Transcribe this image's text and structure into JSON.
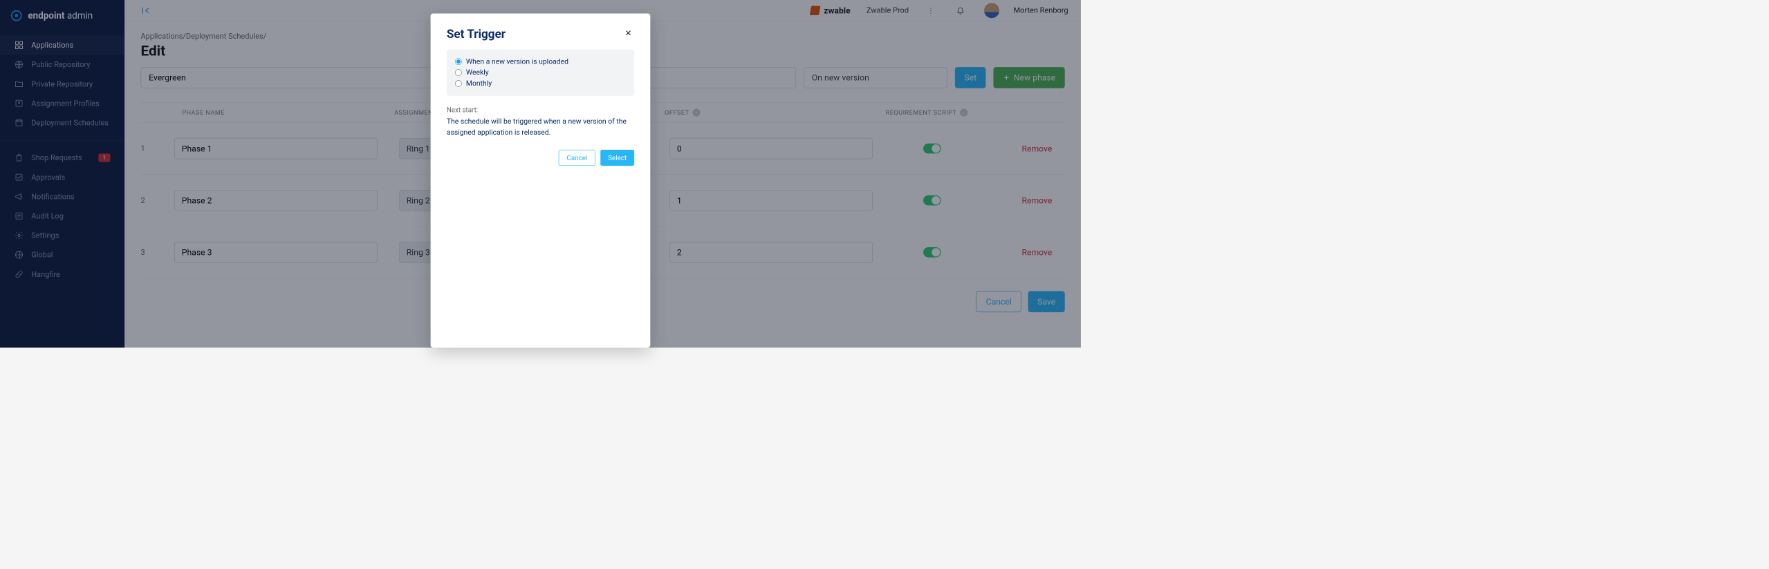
{
  "brand": {
    "logo_bold": "endpoint",
    "logo_light": " admin"
  },
  "sidebar": {
    "items": [
      {
        "label": "Applications",
        "icon": "apps"
      },
      {
        "label": "Public Repository",
        "icon": "globe"
      },
      {
        "label": "Private Repository",
        "icon": "folder-lock"
      },
      {
        "label": "Assignment Profiles",
        "icon": "profile"
      },
      {
        "label": "Deployment Schedules",
        "icon": "calendar"
      }
    ],
    "items2": [
      {
        "label": "Shop Requests",
        "icon": "bag",
        "badge": "1"
      },
      {
        "label": "Approvals",
        "icon": "check"
      },
      {
        "label": "Notifications",
        "icon": "megaphone"
      },
      {
        "label": "Audit Log",
        "icon": "list"
      },
      {
        "label": "Settings",
        "icon": "gear"
      },
      {
        "label": "Global",
        "icon": "globe"
      },
      {
        "label": "Hangfire",
        "icon": "link"
      }
    ]
  },
  "topbar": {
    "brand": "zwable",
    "tenant": "Zwable Prod",
    "user": "Morten Renborg"
  },
  "page": {
    "breadcrumb": "Applications/Deployment Schedules/",
    "title": "Edit",
    "name_value": "Evergreen",
    "trigger_value": "On new version",
    "set_label": "Set",
    "new_phase_label": "New phase",
    "cancel_label": "Cancel",
    "save_label": "Save"
  },
  "columns": {
    "phase": "PHASE NAME",
    "profile": "ASSIGNMENT PROFILE",
    "offset": "OFFSET",
    "req": "REQUIREMENT SCRIPT"
  },
  "phases": [
    {
      "idx": "1",
      "name": "Phase 1",
      "profile": "Ring 1",
      "offset": "0",
      "remove": "Remove"
    },
    {
      "idx": "2",
      "name": "Phase 2",
      "profile": "Ring 2",
      "offset": "1",
      "remove": "Remove"
    },
    {
      "idx": "3",
      "name": "Phase 3",
      "profile": "Ring 3",
      "offset": "2",
      "remove": "Remove"
    }
  ],
  "modal": {
    "title": "Set Trigger",
    "options": [
      "When a new version is uploaded",
      "Weekly",
      "Monthly"
    ],
    "next_label": "Next start:",
    "desc": "The schedule will be triggered when a new version of the assigned application is released.",
    "cancel": "Cancel",
    "select": "Select"
  }
}
